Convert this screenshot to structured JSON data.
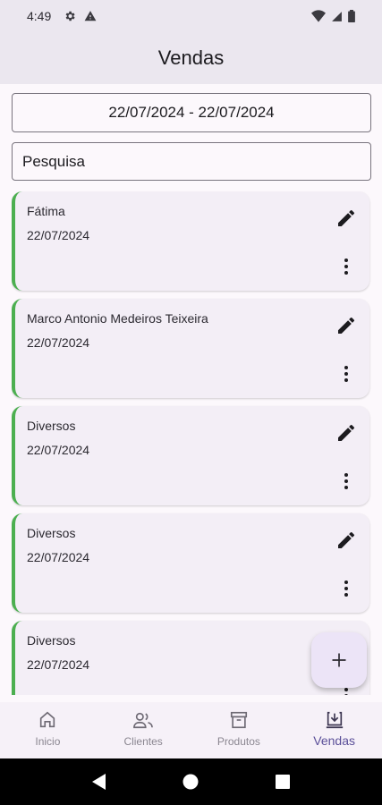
{
  "status_bar": {
    "time": "4:49",
    "icons": [
      "gear-icon",
      "warning-icon"
    ],
    "right_icons": [
      "wifi-icon",
      "signal-icon",
      "battery-icon"
    ]
  },
  "app_bar": {
    "title": "Vendas"
  },
  "filters": {
    "date_range": "22/07/2024 - 22/07/2024",
    "search_placeholder": "Pesquisa"
  },
  "colors": {
    "accent_bar": "#4caf50",
    "active_nav": "#5b5099"
  },
  "sales": [
    {
      "name": "Fátima",
      "date": "22/07/2024"
    },
    {
      "name": "Marco Antonio Medeiros Teixeira",
      "date": "22/07/2024"
    },
    {
      "name": "Diversos",
      "date": "22/07/2024"
    },
    {
      "name": "Diversos",
      "date": "22/07/2024"
    },
    {
      "name": "Diversos",
      "date": "22/07/2024"
    }
  ],
  "bottom_nav": [
    {
      "label": "Inicio",
      "icon": "home-icon"
    },
    {
      "label": "Clientes",
      "icon": "people-icon"
    },
    {
      "label": "Produtos",
      "icon": "archive-icon"
    },
    {
      "label": "Vendas",
      "icon": "download-icon",
      "active": true
    }
  ]
}
